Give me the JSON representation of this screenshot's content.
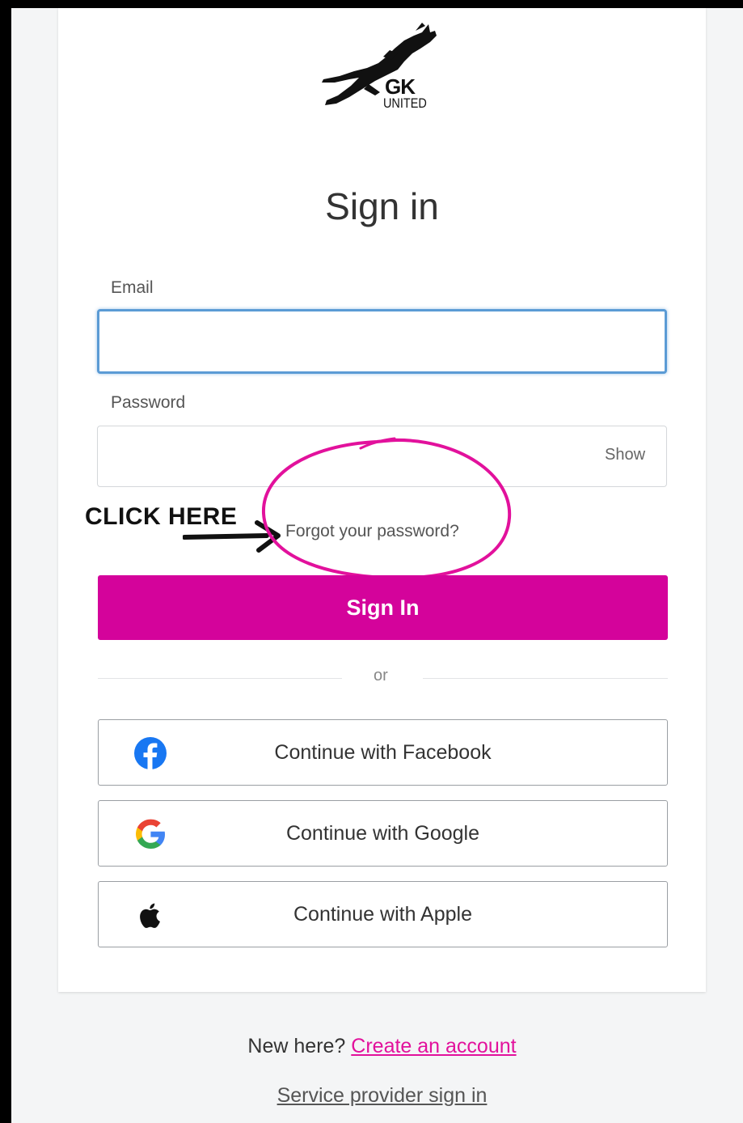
{
  "logo": {
    "line1": "GK",
    "line2": "UNITED"
  },
  "title": "Sign in",
  "email": {
    "label": "Email",
    "value": "",
    "placeholder": ""
  },
  "password": {
    "label": "Password",
    "value": "",
    "placeholder": "",
    "show_label": "Show"
  },
  "annotation": {
    "text": "CLICK HERE",
    "color": "#e2119c"
  },
  "forgot_label": "Forgot your password?",
  "signin_label": "Sign In",
  "divider_label": "or",
  "social": {
    "facebook_label": "Continue with Facebook",
    "google_label": "Continue with Google",
    "apple_label": "Continue with Apple"
  },
  "footer": {
    "new_here": "New here?",
    "create_account": "Create an account",
    "service_provider": "Service provider sign in"
  },
  "colors": {
    "brand": "#d4039b",
    "link": "#e2119c",
    "focus": "#5b9bd5",
    "facebook": "#1877f2"
  }
}
